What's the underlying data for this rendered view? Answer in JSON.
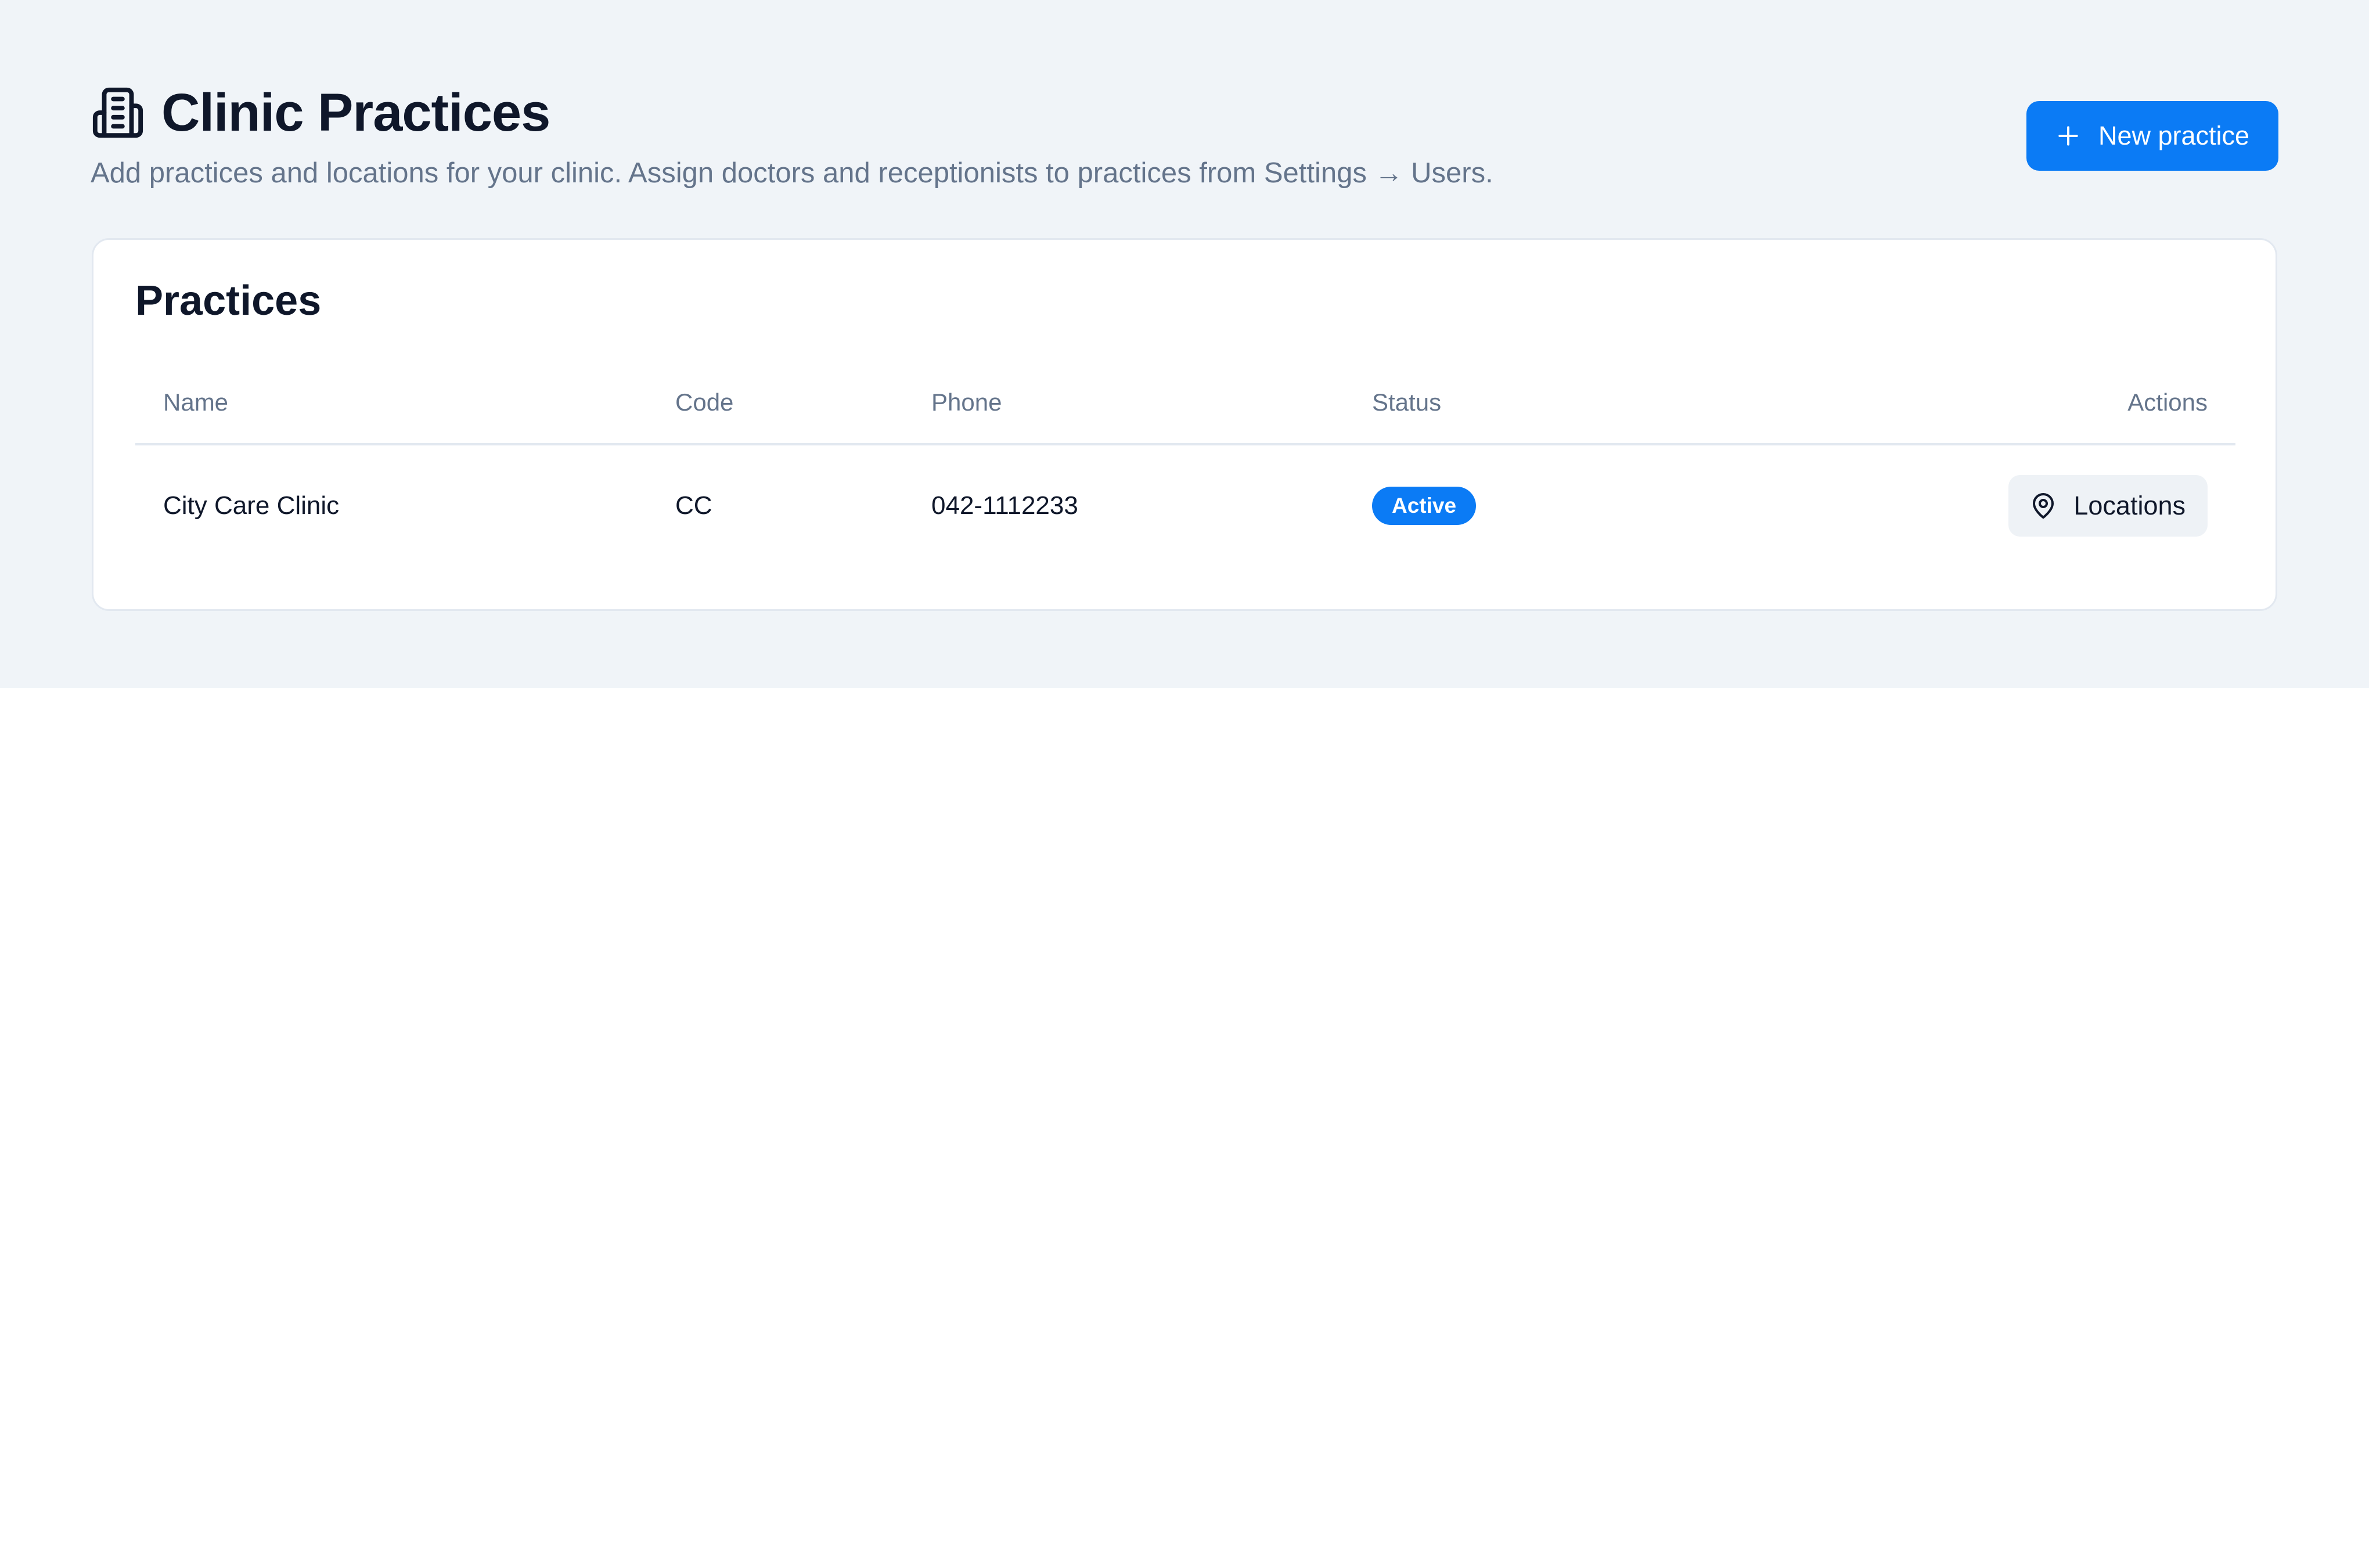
{
  "header": {
    "title": "Clinic Practices",
    "title_icon": "building-icon",
    "subtitle": "Add practices and locations for your clinic. Assign doctors and receptionists to practices from Settings → Users.",
    "new_button": {
      "label": "New practice",
      "icon": "plus-icon"
    }
  },
  "practices_card": {
    "title": "Practices",
    "columns": {
      "name": "Name",
      "code": "Code",
      "phone": "Phone",
      "status": "Status",
      "actions": "Actions"
    },
    "rows": [
      {
        "name": "City Care Clinic",
        "code": "CC",
        "phone": "042-1112233",
        "status": "Active",
        "action_label": "Locations",
        "action_icon": "map-pin-icon"
      }
    ]
  },
  "colors": {
    "accent": "#0b7bf5",
    "page_background": "#f0f4f8",
    "heading_text": "#0f172a",
    "muted_text": "#64748b",
    "border": "#e2e8f0",
    "secondary_button_bg": "#eef2f6"
  }
}
